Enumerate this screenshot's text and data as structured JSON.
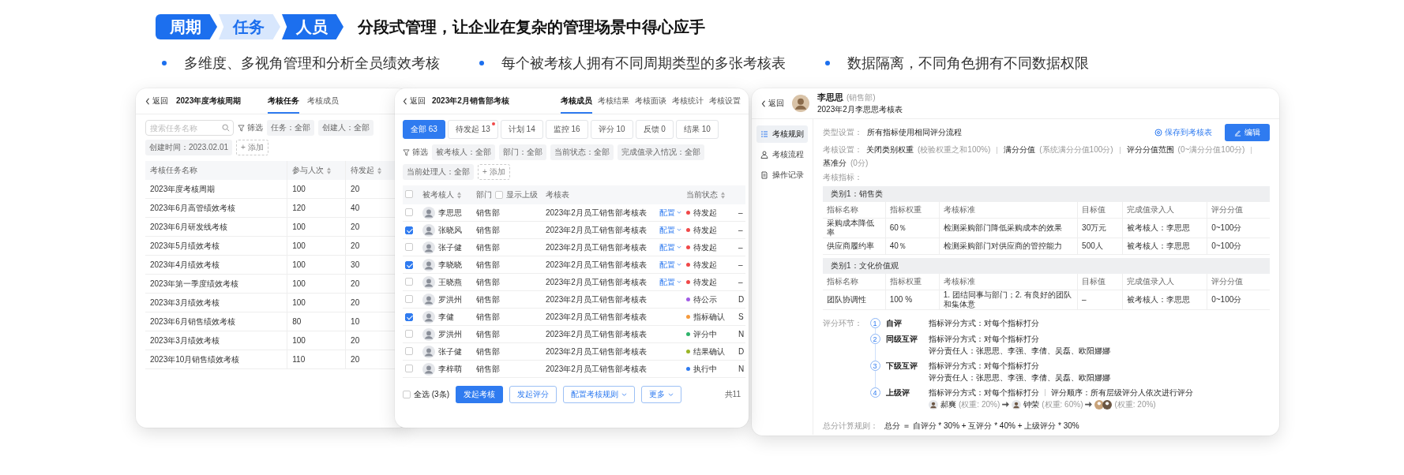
{
  "header": {
    "tags": [
      {
        "label": "周期",
        "highlight": true
      },
      {
        "label": "任务",
        "highlight": false
      },
      {
        "label": "人员",
        "highlight": true
      }
    ],
    "title": "分段式管理，让企业在复杂的管理场景中得心应手",
    "bullets": [
      "多维度、多视角管理和分析全员绩效考核",
      "每个被考核人拥有不同周期类型的多张考核表",
      "数据隔离，不同角色拥有不同数据权限"
    ]
  },
  "cycle_window": {
    "back": "返回",
    "title": "2023年度考核周期",
    "tabs": [
      {
        "label": "考核任务",
        "selected": true
      },
      {
        "label": "考核成员",
        "selected": false
      }
    ],
    "search": {
      "placeholder": "搜索任务名称"
    },
    "filter_label": "筛选",
    "filters": [
      "任务：全部",
      "创建人：全部",
      "创建时间：2023.02.01"
    ],
    "add_filter": "+ 添加",
    "table": {
      "columns": [
        {
          "label": "考核任务名称",
          "sortable": false
        },
        {
          "label": "参与人次",
          "sortable": true
        },
        {
          "label": "待发起",
          "sortable": true
        }
      ],
      "rows": [
        [
          "2023年度考核周期",
          "100",
          "20"
        ],
        [
          "2023年6月高管绩效考核",
          "120",
          "40"
        ],
        [
          "2023年6月研发线考核",
          "100",
          "20"
        ],
        [
          "2023年5月绩效考核",
          "100",
          "20"
        ],
        [
          "2023年4月绩效考核",
          "100",
          "30"
        ],
        [
          "2023年第一季度绩效考核",
          "100",
          "20"
        ],
        [
          "2023年3月绩效考核",
          "100",
          "20"
        ],
        [
          "2023年6月销售绩效考核",
          "80",
          "10"
        ],
        [
          "2023年3月绩效考核",
          "100",
          "20"
        ],
        [
          "2023年10月销售绩效考核",
          "110",
          "20"
        ]
      ]
    }
  },
  "task_window": {
    "back": "返回",
    "title": "2023年2月销售部考核",
    "tabs": [
      {
        "label": "考核成员",
        "selected": true
      },
      {
        "label": "考核结果",
        "selected": false
      },
      {
        "label": "考核面谈",
        "selected": false
      },
      {
        "label": "考核统计",
        "selected": false
      },
      {
        "label": "考核设置",
        "selected": false
      }
    ],
    "status_tabs": [
      {
        "label": "全部 63",
        "selected": true,
        "dot": false
      },
      {
        "label": "待发起 13",
        "selected": false,
        "dot": true
      },
      {
        "label": "计划 14",
        "selected": false,
        "dot": false
      },
      {
        "label": "监控 16",
        "selected": false,
        "dot": false
      },
      {
        "label": "评分 10",
        "selected": false,
        "dot": false
      },
      {
        "label": "反馈 0",
        "selected": false,
        "dot": false
      },
      {
        "label": "结果 10",
        "selected": false,
        "dot": false
      }
    ],
    "filter_label": "筛选",
    "filters": [
      "被考核人：全部",
      "部门：全部",
      "当前状态：全部",
      "完成值录入情况：全部",
      "当前处理人：全部"
    ],
    "add_filter": "+ 添加",
    "columns": {
      "checked": false,
      "person": "被考核人",
      "dept": "部门",
      "dept_option": {
        "label": "显示上级",
        "checked": false
      },
      "sheet": "考核表",
      "status": "当前状态"
    },
    "rows": [
      {
        "checked": false,
        "name": "李思思",
        "dept": "销售部",
        "sheet": "2023年2月员工销售部考核表",
        "config": "配置",
        "status": "待发起",
        "color": "#f04848",
        "column_6": "–"
      },
      {
        "checked": true,
        "name": "张晓风",
        "dept": "销售部",
        "sheet": "2023年2月员工销售部考核表",
        "config": "配置",
        "status": "待发起",
        "color": "#f04848",
        "column_6": "–"
      },
      {
        "checked": false,
        "name": "张子健",
        "dept": "销售部",
        "sheet": "2023年2月员工销售部考核表",
        "config": "配置",
        "status": "待发起",
        "color": "#f04848",
        "column_6": "–"
      },
      {
        "checked": true,
        "name": "李晓晓",
        "dept": "销售部",
        "sheet": "2023年2月员工销售部考核表",
        "config": "配置",
        "status": "待发起",
        "color": "#f04848",
        "column_6": "–"
      },
      {
        "checked": false,
        "name": "王晓燕",
        "dept": "销售部",
        "sheet": "2023年2月员工销售部考核表",
        "config": "配置",
        "status": "待发起",
        "color": "#f04848",
        "column_6": "–"
      },
      {
        "checked": false,
        "name": "罗洪州",
        "dept": "销售部",
        "sheet": "2023年2月员工销售部考核表",
        "status": "待公示",
        "color": "#a15ce6",
        "column_6": "D"
      },
      {
        "checked": true,
        "name": "李健",
        "dept": "销售部",
        "sheet": "2023年2月员工销售部考核表",
        "status": "指标确认",
        "color": "#f59a3c",
        "column_6": "S"
      },
      {
        "checked": false,
        "name": "罗洪州",
        "dept": "销售部",
        "sheet": "2023年2月员工销售部考核表",
        "status": "评分中",
        "color": "#2fb36b",
        "column_6": "N"
      },
      {
        "checked": false,
        "name": "张子健",
        "dept": "销售部",
        "sheet": "2023年2月员工销售部考核表",
        "status": "结果确认",
        "color": "#9ab526",
        "column_6": "D"
      },
      {
        "checked": false,
        "name": "李梓萌",
        "dept": "销售部",
        "sheet": "2023年2月员工销售部考核表",
        "status": "执行中",
        "color": "#2f7bf0",
        "column_6": "N"
      }
    ],
    "select_all": {
      "label": "全选 (3条)",
      "checked": false
    },
    "buttons": [
      {
        "label": "发起考核",
        "kind": "primary"
      },
      {
        "label": "发起评分",
        "kind": "plain"
      },
      {
        "label": "配置考核规则",
        "kind": "dropdown"
      },
      {
        "label": "更多",
        "kind": "dropdown"
      }
    ],
    "total": "共11"
  },
  "review_window": {
    "back": "返回",
    "person": {
      "name": "李思思",
      "dept": "(销售部)",
      "subtitle": "2023年2月李思思考核表"
    },
    "nav": [
      {
        "label": "考核规则",
        "selected": true
      },
      {
        "label": "考核流程",
        "selected": false
      },
      {
        "label": "操作记录",
        "selected": false
      }
    ],
    "type_setting": {
      "label": "类型设置：",
      "value": "所有指标使用相同评分流程"
    },
    "save_button": "保存到考核表",
    "edit_button": "编辑",
    "settings": {
      "label": "考核设置：",
      "items": [
        {
          "name": "关闭类别权重",
          "note": "(校验权重之和100%)"
        },
        {
          "name": "满分分值",
          "note": "(系统满分分值100分)"
        },
        {
          "name": "评分分值范围",
          "note": "(0~满分分值100分)"
        },
        {
          "name": "基准分",
          "note": "(0分)"
        }
      ]
    },
    "indicators_label": "考核指标：",
    "categories": [
      {
        "title": "类别1：销售类",
        "columns": [
          "指标名称",
          "指标权重",
          "考核标准",
          "目标值",
          "完成值录入人",
          "评分分值"
        ],
        "rows": [
          [
            "采购成本降低率",
            "60％",
            "检测采购部门降低采购成本的效果",
            "30万元",
            "被考核人：李思思",
            "0~100分"
          ],
          [
            "供应商履约率",
            "40％",
            "检测采购部门对供应商的管控能力",
            "500人",
            "被考核人：李思思",
            "0~100分"
          ]
        ]
      },
      {
        "title": "类别1：文化价值观",
        "columns": [
          "指标名称",
          "指标权重",
          "考核标准",
          "目标值",
          "完成值录入人",
          "评分分值"
        ],
        "rows": [
          [
            "团队协调性",
            "100 %",
            "1. 团结同事与部门；2. 有良好的团队和集体意",
            "–",
            "被考核人：李思思",
            "0~100分"
          ]
        ]
      }
    ],
    "steps_label": "评分环节：",
    "steps": [
      {
        "num": "1",
        "name": "自评",
        "lines": [
          [
            "指标评分方式：对每个指标打分"
          ]
        ]
      },
      {
        "num": "2",
        "name": "同级互评",
        "lines": [
          [
            "指标评分方式：对每个指标打分"
          ],
          [
            "评分责任人：张思思、李强、李倩、吴磊、欧阳娜娜"
          ]
        ]
      },
      {
        "num": "3",
        "name": "下级互评",
        "lines": [
          [
            "指标评分方式：对每个指标打分"
          ],
          [
            "评分责任人：张思思、李强、李倩、吴磊、欧阳娜娜"
          ]
        ]
      },
      {
        "num": "4",
        "name": "上级评",
        "lines": [
          [
            "指标评分方式：对每个指标打分",
            "评分顺序：所有层级评分人依次进行评分"
          ]
        ],
        "reviewers": [
          {
            "group": false,
            "name": "郝爽",
            "weight": "(权重: 20%)"
          },
          {
            "group": false,
            "name": "钟荣",
            "weight": "(权重: 60%)"
          },
          {
            "group": true,
            "weight": "(权重: 20%)"
          }
        ]
      }
    ],
    "total": {
      "label": "总分计算规则：",
      "formula": "总分 ＝ 自评分 * 30% + 互评分 * 40% + 上级评分 * 30%"
    }
  }
}
